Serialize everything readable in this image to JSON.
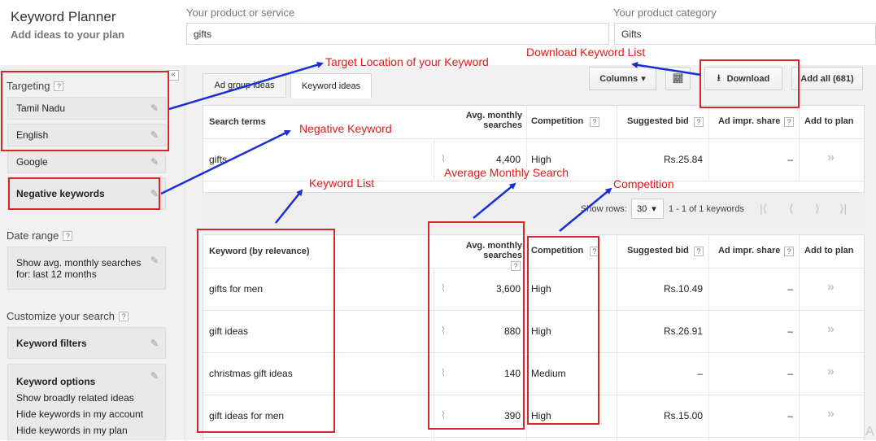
{
  "header": {
    "title": "Keyword Planner",
    "subtitle": "Add ideas to your plan",
    "product_label": "Your product or service",
    "product_value": "gifts",
    "category_label": "Your product category",
    "category_value": "Gifts"
  },
  "sidebar": {
    "collapse_glyph": "«",
    "targeting_label": "Targeting",
    "targeting_items": [
      "Tamil Nadu",
      "English",
      "Google",
      "Negative keywords"
    ],
    "date_range_label": "Date range",
    "date_range_line1": "Show avg. monthly searches",
    "date_range_line2": "for: last 12 months",
    "customize_label": "Customize your search",
    "keyword_filters": "Keyword filters",
    "keyword_options": "Keyword options",
    "options": [
      "Show broadly related ideas",
      "Hide keywords in my account",
      "Hide keywords in my plan"
    ],
    "help": "?"
  },
  "tabs": [
    "Ad group ideas",
    "Keyword ideas"
  ],
  "toolbar": {
    "columns": "Columns",
    "download": "Download",
    "add_all": "Add all (681)"
  },
  "search_table": {
    "headers": {
      "term": "Search terms",
      "avg1": "Avg. monthly",
      "avg2": "searches",
      "competition": "Competition",
      "bid": "Suggested bid",
      "share": "Ad impr. share",
      "add": "Add to plan"
    },
    "row": {
      "term": "gifts",
      "searches": "4,400",
      "competition": "High",
      "bid": "Rs.25.84",
      "share": "–",
      "add": "»"
    }
  },
  "pager": {
    "show_rows_label": "Show rows:",
    "rows": "30",
    "range": "1 - 1 of 1 keywords"
  },
  "keyword_table": {
    "headers": {
      "keyword": "Keyword (by relevance)",
      "avg1": "Avg. monthly",
      "avg2": "searches",
      "competition": "Competition",
      "bid": "Suggested bid",
      "share": "Ad impr. share",
      "add": "Add to plan"
    },
    "rows": [
      {
        "keyword": "gifts for men",
        "searches": "3,600",
        "competition": "High",
        "bid": "Rs.10.49",
        "share": "–",
        "add": "»"
      },
      {
        "keyword": "gift ideas",
        "searches": "880",
        "competition": "High",
        "bid": "Rs.26.91",
        "share": "–",
        "add": "»"
      },
      {
        "keyword": "christmas gift ideas",
        "searches": "140",
        "competition": "Medium",
        "bid": "–",
        "share": "–",
        "add": "»"
      },
      {
        "keyword": "gift ideas for men",
        "searches": "390",
        "competition": "High",
        "bid": "Rs.15.00",
        "share": "–",
        "add": "»"
      }
    ]
  },
  "annotations": {
    "target_location": "Target Location of your Keyword",
    "download_list": "Download Keyword List",
    "negative_keyword": "Negative Keyword",
    "keyword_list": "Keyword List",
    "avg_monthly": "Average Monthly Search",
    "competition": "Competition"
  },
  "corner_mark": "A",
  "colors": {
    "annotation_red": "#d4262b",
    "arrow_blue": "#1a2fd6"
  }
}
